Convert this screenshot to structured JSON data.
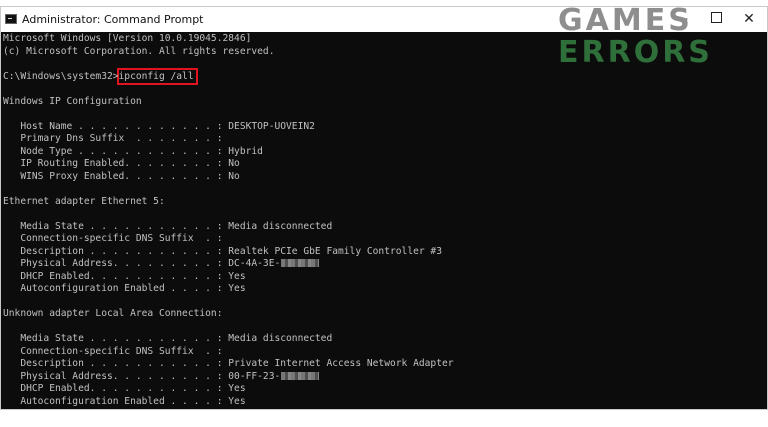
{
  "window": {
    "title": "Administrator: Command Prompt",
    "logo_line1": "GAMES",
    "logo_line2": "ERRORS",
    "min_glyph": "—",
    "close_glyph": "✕"
  },
  "console": {
    "lines": [
      "Microsoft Windows [Version 10.0.19045.2846]",
      "(c) Microsoft Corporation. All rights reserved.",
      "",
      "C:\\Windows\\system32>ipconfig /all",
      "",
      "Windows IP Configuration",
      "",
      "   Host Name . . . . . . . . . . . . : DESKTOP-UOVEIN2",
      "   Primary Dns Suffix  . . . . . . . :",
      "   Node Type . . . . . . . . . . . . : Hybrid",
      "   IP Routing Enabled. . . . . . . . : No",
      "   WINS Proxy Enabled. . . . . . . . : No",
      "",
      "Ethernet adapter Ethernet 5:",
      "",
      "   Media State . . . . . . . . . . . : Media disconnected",
      "   Connection-specific DNS Suffix  . :",
      "   Description . . . . . . . . . . . : Realtek PCIe GbE Family Controller #3",
      "   Physical Address. . . . . . . . . : DC-4A-3E-",
      "   DHCP Enabled. . . . . . . . . . . : Yes",
      "   Autoconfiguration Enabled . . . . : Yes",
      "",
      "Unknown adapter Local Area Connection:",
      "",
      "   Media State . . . . . . . . . . . : Media disconnected",
      "   Connection-specific DNS Suffix  . :",
      "   Description . . . . . . . . . . . : Private Internet Access Network Adapter",
      "   Physical Address. . . . . . . . . : 00-FF-23-",
      "   DHCP Enabled. . . . . . . . . . . : Yes",
      "   Autoconfiguration Enabled . . . . : Yes"
    ],
    "redacted_lines": [
      18,
      27
    ],
    "highlighted_command": "ipconfig /all"
  }
}
